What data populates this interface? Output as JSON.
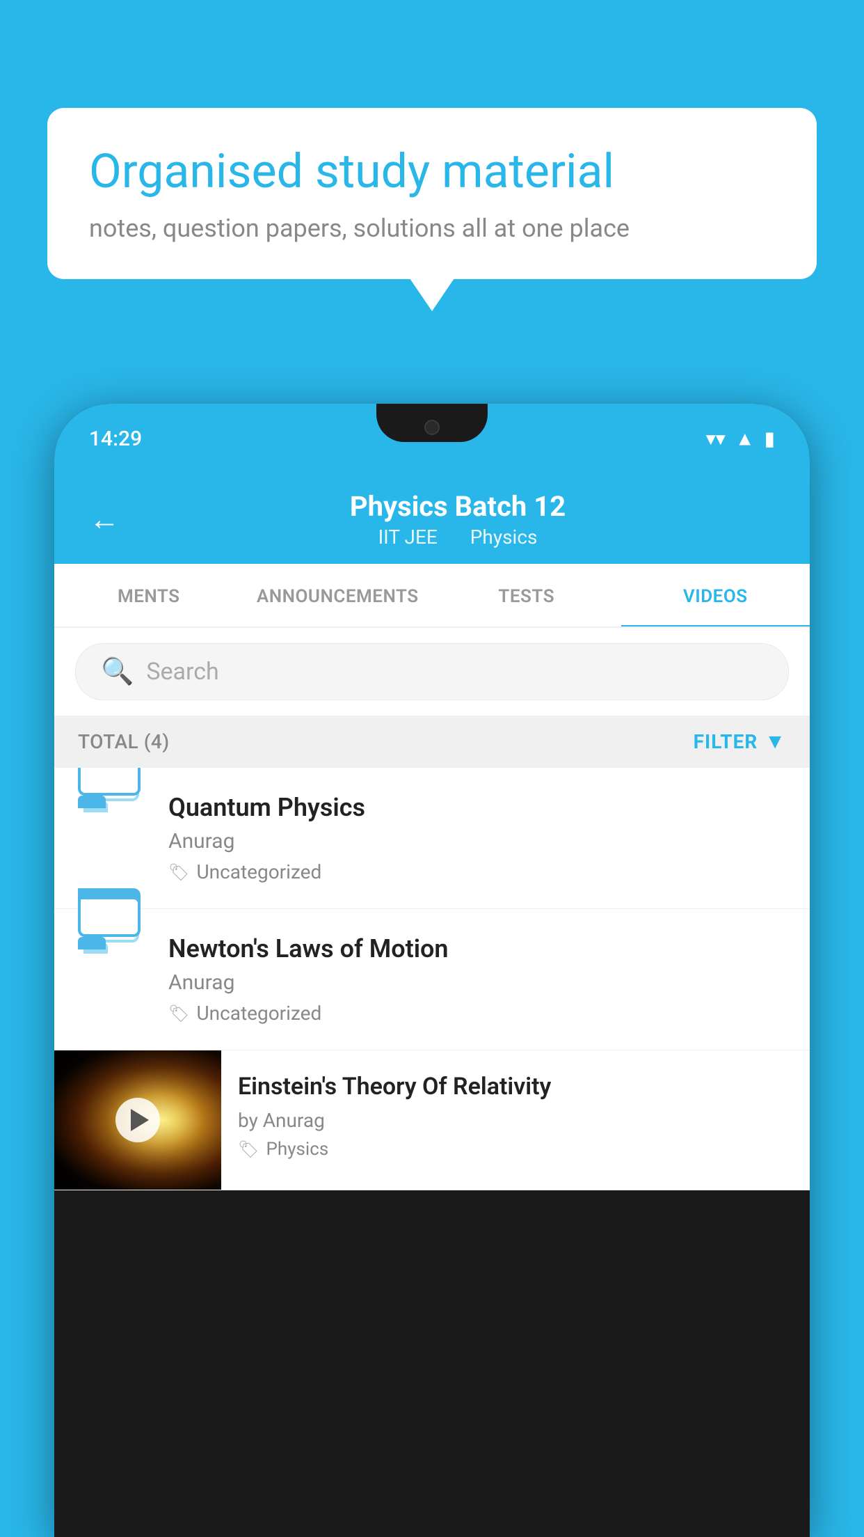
{
  "background_color": "#29b6e8",
  "speech_bubble": {
    "title": "Organised study material",
    "subtitle": "notes, question papers, solutions all at one place"
  },
  "phone": {
    "status_bar": {
      "time": "14:29",
      "wifi_icon": "wifi",
      "signal_icon": "signal",
      "battery_icon": "battery"
    },
    "app_header": {
      "back_label": "←",
      "title": "Physics Batch 12",
      "subtitle_left": "IIT JEE",
      "subtitle_right": "Physics"
    },
    "tabs": [
      {
        "label": "MENTS",
        "active": false
      },
      {
        "label": "ANNOUNCEMENTS",
        "active": false
      },
      {
        "label": "TESTS",
        "active": false
      },
      {
        "label": "VIDEOS",
        "active": true
      }
    ],
    "search": {
      "placeholder": "Search"
    },
    "filter_bar": {
      "total_label": "TOTAL (4)",
      "filter_label": "FILTER"
    },
    "video_items": [
      {
        "title": "Quantum Physics",
        "author": "Anurag",
        "tag": "Uncategorized",
        "type": "folder"
      },
      {
        "title": "Newton's Laws of Motion",
        "author": "Anurag",
        "tag": "Uncategorized",
        "type": "folder"
      },
      {
        "title": "Einstein's Theory Of Relativity",
        "author": "by Anurag",
        "tag": "Physics",
        "type": "video"
      }
    ]
  }
}
